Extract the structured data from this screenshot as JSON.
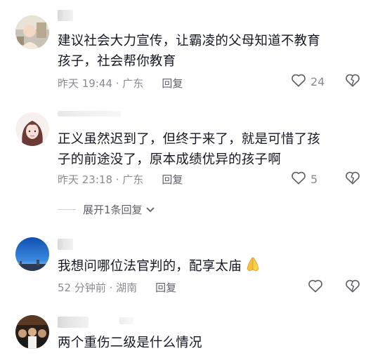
{
  "comments": [
    {
      "text_line1": "建议社会大力宣传，让霸凌的父母知道不教育",
      "text_line2": "孩子，社会帮你教育",
      "time": "昨天 19:44 · 广东",
      "reply": "回复",
      "likes": "24"
    },
    {
      "text_line1": "正义虽然迟到了，但终于来了，就是可惜了孩",
      "text_line2": "子的前途没了，原本成绩优异的孩子啊",
      "time": "昨天 23:18 · 广东",
      "reply": "回复",
      "likes": "5"
    },
    {
      "text_line1": "我想问哪位法官判的，配享太庙",
      "emoji": "🙏",
      "time": "52 分钟前 · 湖南",
      "reply": "回复",
      "likes": ""
    },
    {
      "text_line1": "两个重伤二级是什么情况"
    }
  ],
  "expand_replies": "展开1条回复",
  "icons": {
    "like": "heart-outline-icon",
    "dislike": "broken-heart-outline-icon",
    "expand": "chevron-down-icon"
  },
  "colors": {
    "text": "#161823",
    "meta": "#8a8b91",
    "reply": "#606168"
  }
}
